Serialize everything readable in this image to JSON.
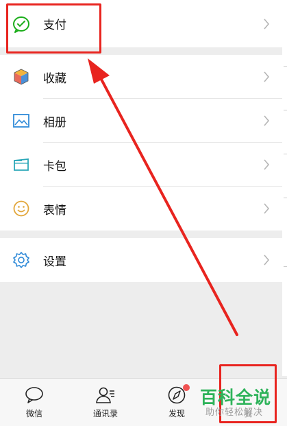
{
  "menu": {
    "pay": "支付",
    "favorites": "收藏",
    "album": "相册",
    "cards": "卡包",
    "stickers": "表情",
    "settings": "设置"
  },
  "tabbar": {
    "chats": "微信",
    "contacts": "通讯录",
    "discover": "发现",
    "me": "我"
  },
  "watermark": {
    "title": "百科全说",
    "subtitle": "助你轻松解决"
  },
  "colors": {
    "accent": "#1aad19",
    "annotation": "#e8241f",
    "badge": "#f05252"
  },
  "icons": {
    "pay": "pay-icon",
    "favorites": "cube-icon",
    "album": "picture-icon",
    "cards": "wallet-icon",
    "stickers": "smiley-icon",
    "settings": "gear-icon",
    "chevron": "chevron-right-icon",
    "chats": "chat-bubble-icon",
    "contacts": "contacts-icon",
    "discover": "compass-icon"
  }
}
